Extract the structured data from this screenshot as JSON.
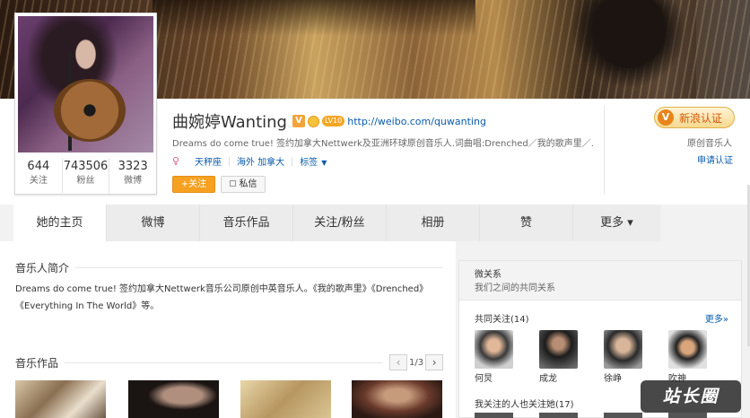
{
  "profile": {
    "name": "曲婉婷Wanting",
    "vip_badge": "V",
    "level": "LV10",
    "homepage_url": "http://weibo.com/quwanting",
    "bio": "Dreams do come true! 签约加拿大Nettwerk及亚洲环球原创音乐人.词曲唱:Drenched／我的歌声里／...",
    "gender_icon": "♀",
    "constellation": "天秤座",
    "location": "海外 加拿大",
    "tags_label": "标签",
    "follow_button": "+关注",
    "message_button": "私信",
    "stats": [
      {
        "num": "644",
        "label": "关注"
      },
      {
        "num": "743506",
        "label": "粉丝"
      },
      {
        "num": "3323",
        "label": "微博"
      }
    ]
  },
  "cert": {
    "badge_letter": "V",
    "button_label": "新浪认证",
    "type": "原创音乐人",
    "apply_link": "申请认证"
  },
  "tabs": [
    {
      "label": "她的主页"
    },
    {
      "label": "微博"
    },
    {
      "label": "音乐作品"
    },
    {
      "label": "关注/粉丝"
    },
    {
      "label": "相册"
    },
    {
      "label": "赞"
    },
    {
      "label": "更多 ▾"
    }
  ],
  "intro": {
    "title": "音乐人简介",
    "text": "Dreams do come true! 签约加拿大Nettwerk音乐公司原创中英音乐人。《我的歌声里》《Drenched》《Everything In The World》等。"
  },
  "music": {
    "title": "音乐作品",
    "page": "1/3",
    "prev": "‹",
    "next": "›"
  },
  "sidebar": {
    "title": "微关系",
    "subtitle": "我们之间的共同关系",
    "common_follow": "共同关注(14)",
    "more": "更多»",
    "friends": [
      {
        "name": "何炅"
      },
      {
        "name": "成龙"
      },
      {
        "name": "徐峥"
      },
      {
        "name": "吹神"
      }
    ],
    "also_follow": "我关注的人也关注她(17)"
  },
  "watermark": "站长圈",
  "colors": {
    "link": "#0a5bab",
    "follow_btn": "#f7a120",
    "cert_text": "#d2580c"
  }
}
